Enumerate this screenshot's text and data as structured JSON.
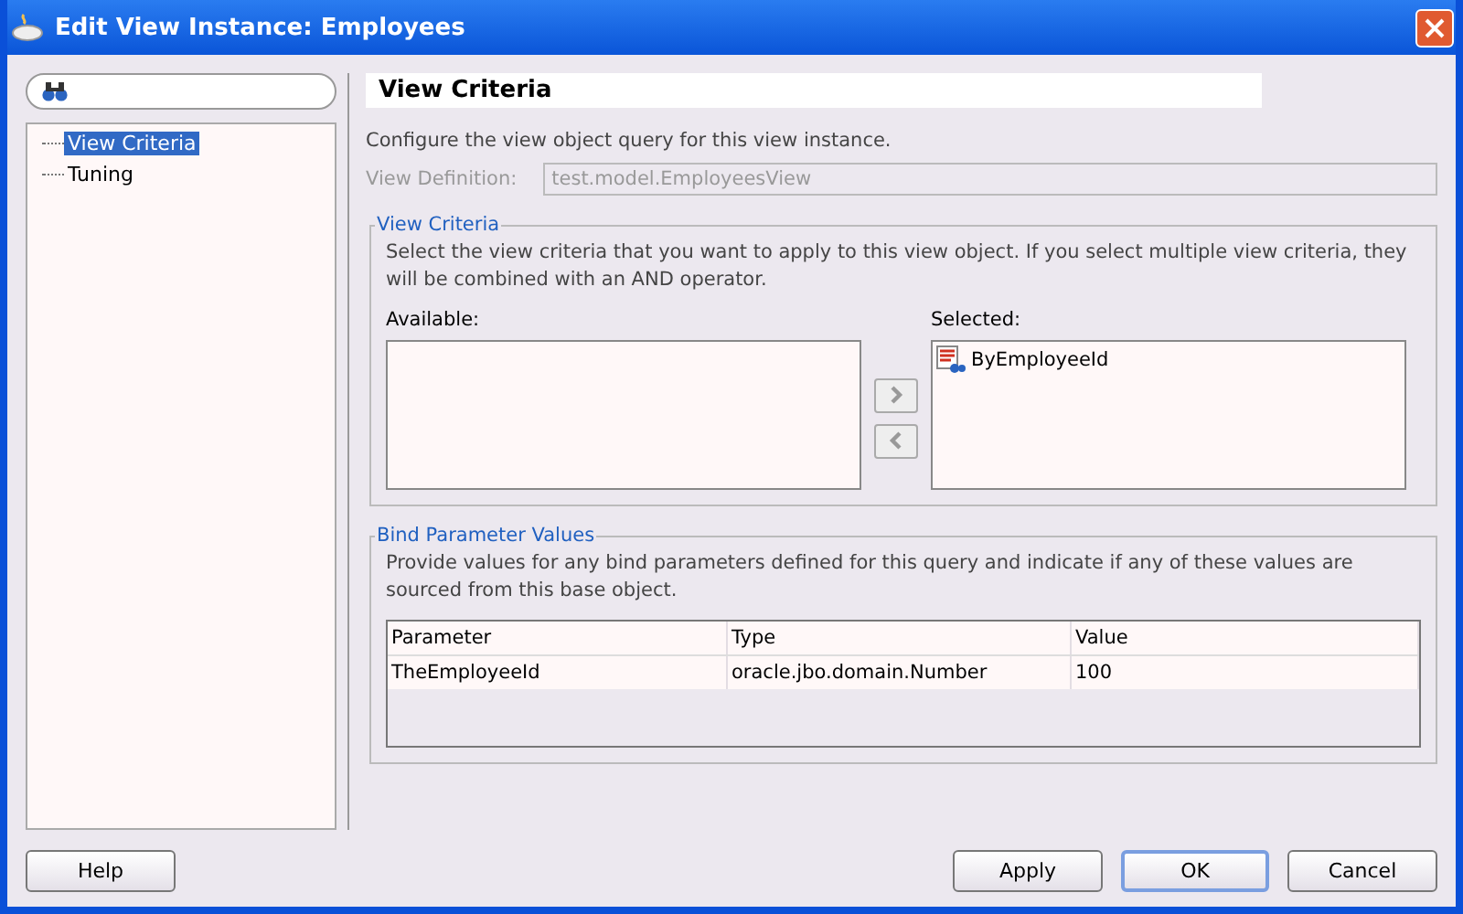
{
  "window": {
    "title": "Edit View Instance: Employees"
  },
  "navigator": {
    "items": [
      {
        "label": "View Criteria",
        "selected": true
      },
      {
        "label": "Tuning",
        "selected": false
      }
    ]
  },
  "page": {
    "heading": "View Criteria",
    "description": "Configure the view object query for this view instance.",
    "view_definition": {
      "label": "View Definition:",
      "value": "test.model.EmployeesView",
      "disabled": true
    }
  },
  "view_criteria": {
    "title": "View Criteria",
    "description": "Select the view criteria that you want to apply to this view object. If you select multiple view criteria, they will be combined with an AND operator.",
    "available": {
      "label": "Available:"
    },
    "selected": {
      "label": "Selected:",
      "items": [
        "ByEmployeeId"
      ]
    }
  },
  "bind_parameters": {
    "title": "Bind Parameter Values",
    "description": "Provide values for any bind parameters defined for this query and indicate if any of these values are sourced from this base object.",
    "columns": [
      "Parameter",
      "Type",
      "Value"
    ],
    "rows": [
      [
        "TheEmployeeId",
        "oracle.jbo.domain.Number",
        "100"
      ]
    ]
  },
  "buttons": [
    {
      "label": "Help",
      "default": false
    },
    {
      "label": "Apply",
      "default": false
    },
    {
      "label": "OK",
      "default": true
    },
    {
      "label": "Cancel",
      "default": false
    }
  ]
}
